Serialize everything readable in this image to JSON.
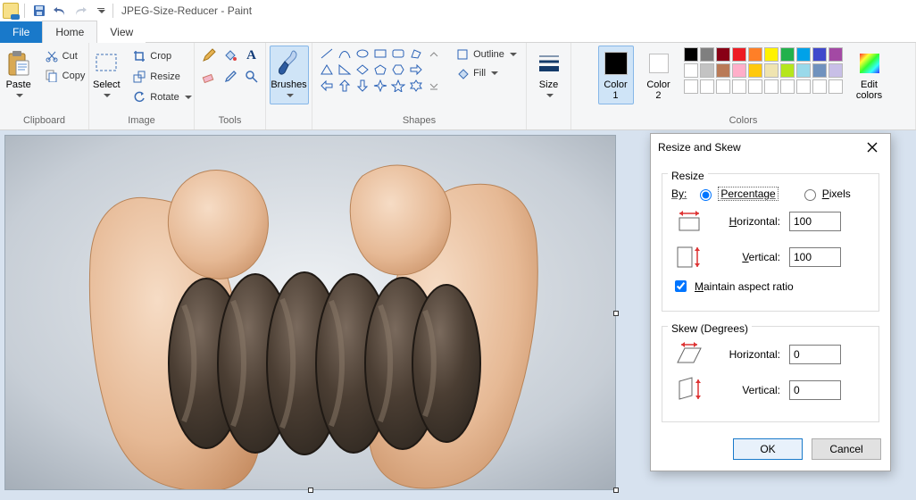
{
  "title": "JPEG-Size-Reducer - Paint",
  "tabs": {
    "file": "File",
    "home": "Home",
    "view": "View"
  },
  "groups": {
    "clipboard": {
      "label": "Clipboard",
      "paste": "Paste",
      "cut": "Cut",
      "copy": "Copy"
    },
    "image": {
      "label": "Image",
      "select": "Select",
      "crop": "Crop",
      "resize": "Resize",
      "rotate": "Rotate"
    },
    "tools": {
      "label": "Tools"
    },
    "brushes": {
      "label": "Brushes"
    },
    "shapes": {
      "label": "Shapes",
      "outline": "Outline",
      "fill": "Fill"
    },
    "size": {
      "label": "Size"
    },
    "colors": {
      "label": "Colors",
      "c1": "Color\n1",
      "c2": "Color\n2",
      "edit": "Edit\ncolors"
    }
  },
  "palette_row1": [
    "#000000",
    "#7f7f7f",
    "#880015",
    "#ed1c24",
    "#ff7f27",
    "#fff200",
    "#22b14c",
    "#00a2e8",
    "#3f48cc",
    "#a349a4"
  ],
  "palette_row2": [
    "#ffffff",
    "#c3c3c3",
    "#b97a57",
    "#ffaec9",
    "#ffc90e",
    "#efe4b0",
    "#b5e61d",
    "#99d9ea",
    "#7092be",
    "#c8bfe7"
  ],
  "palette_row3": [
    "#ffffff",
    "#ffffff",
    "#ffffff",
    "#ffffff",
    "#ffffff",
    "#ffffff",
    "#ffffff",
    "#ffffff",
    "#ffffff",
    "#ffffff"
  ],
  "dialog": {
    "title": "Resize and Skew",
    "resize": "Resize",
    "by": "By:",
    "percentage": "Percentage",
    "pixels": "Pixels",
    "horizontal": "Horizontal:",
    "vertical": "Vertical:",
    "h_val": "100",
    "v_val": "100",
    "maintain": "Maintain aspect ratio",
    "skew": "Skew (Degrees)",
    "sh_val": "0",
    "sv_val": "0",
    "ok": "OK",
    "cancel": "Cancel"
  }
}
